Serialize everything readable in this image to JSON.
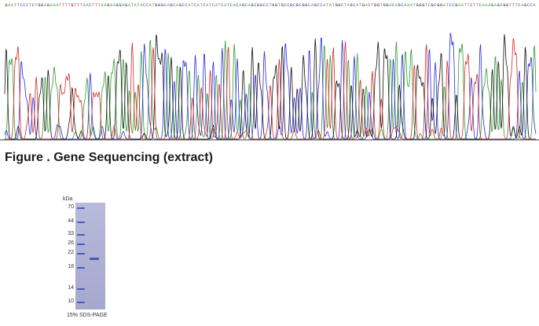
{
  "sequence": {
    "bases": "GAATTCCCTCTGGAGAAATTTTGTTTAACTTTAAGAAGGAGATATACCATGGGCAGCAGCCATCATCATCATCATCACAGCAGCGGCCTGGTGCCGCGCGGCAGCCATATGGCTAGCATGACTGGTGGACAGCAAATGGGTCGCGGATCCGAATTCTTCAAAGAGAGGTTTCAGCCA",
    "base_colors": {
      "A": "#2e9e2e",
      "C": "#2a2ae0",
      "G": "#111111",
      "T": "#d42a2a"
    }
  },
  "caption": "Figure . Gene Sequencing (extract)",
  "gel": {
    "unit_label": "kDa",
    "ladder": [
      "70",
      "44",
      "33",
      "26",
      "22",
      "18",
      "14",
      "10"
    ],
    "label": "15% SDS-PAGE",
    "sample_band_marker": "~20"
  }
}
